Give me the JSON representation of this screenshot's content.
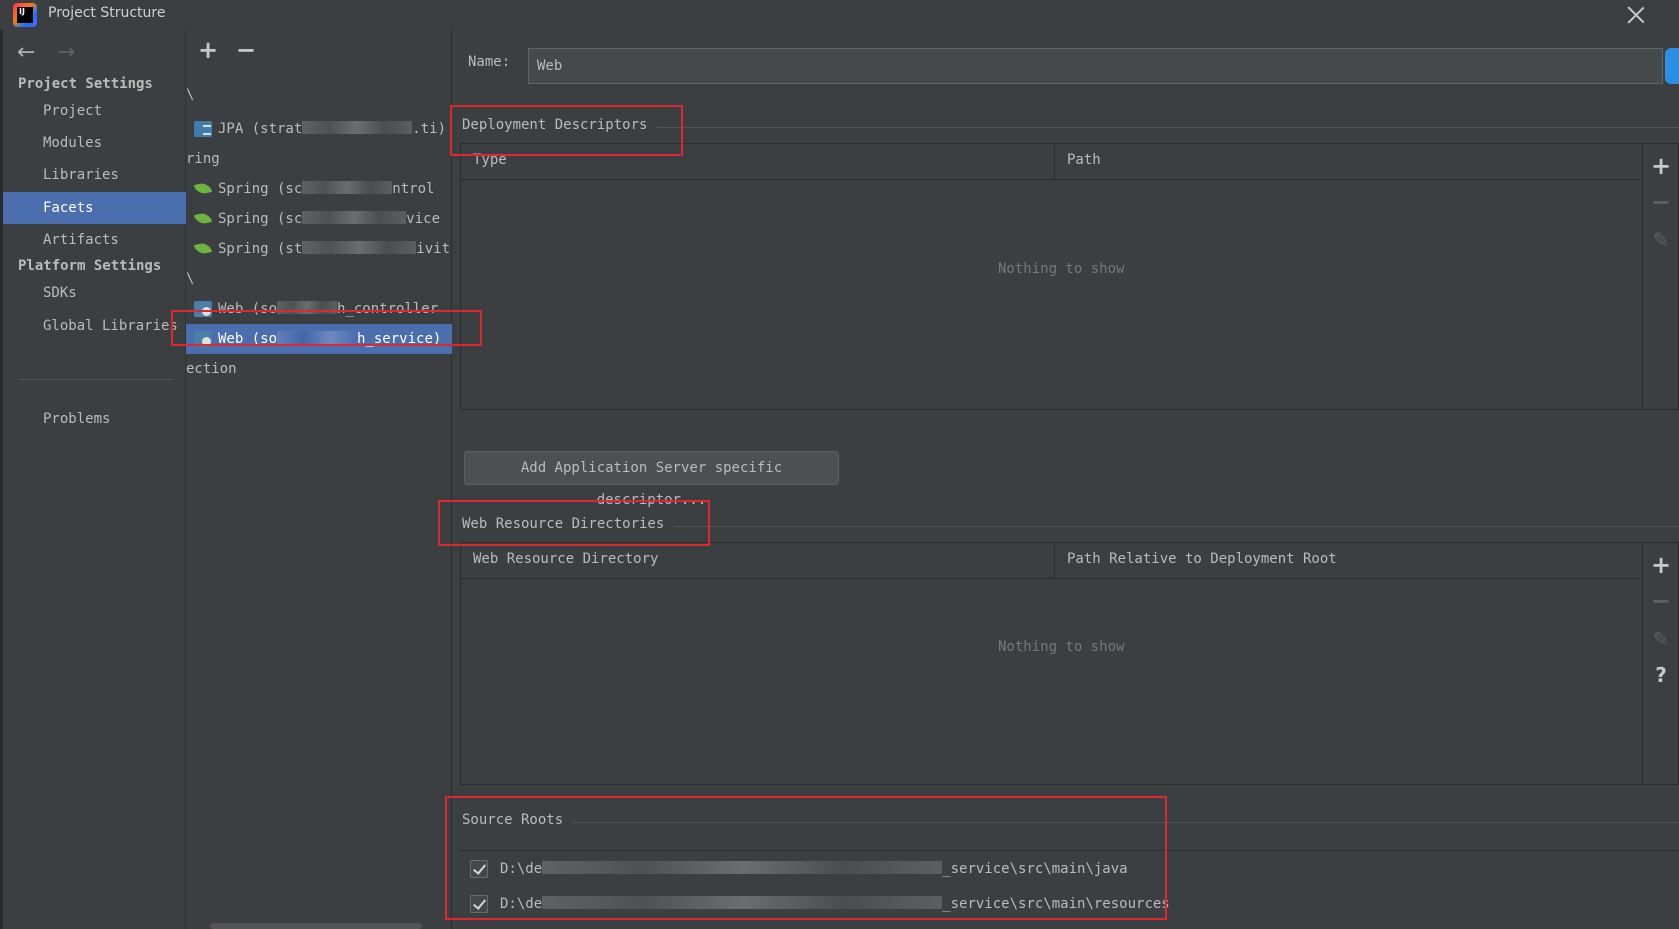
{
  "window": {
    "title": "Project Structure",
    "logo_text": "IJ"
  },
  "sidebar": {
    "project_settings_header": "Project Settings",
    "platform_settings_header": "Platform Settings",
    "items": [
      {
        "label": "Project"
      },
      {
        "label": "Modules"
      },
      {
        "label": "Libraries"
      },
      {
        "label": "Facets",
        "selected": true
      },
      {
        "label": "Artifacts"
      },
      {
        "label": "SDKs"
      },
      {
        "label": "Global Libraries"
      },
      {
        "label": "Problems"
      }
    ],
    "back_icon": "arrow-left-icon",
    "forward_icon": "arrow-right-icon"
  },
  "facet_list": {
    "toolbar": {
      "add": "+",
      "remove": "−"
    },
    "rows": [
      {
        "type": "group",
        "label": "\\"
      },
      {
        "type": "item",
        "icon": "jpa-icon",
        "prefix": "JPA (strat",
        "suffix": ".ti)"
      },
      {
        "type": "group",
        "label": "ring"
      },
      {
        "type": "item",
        "icon": "spring-icon",
        "prefix": "Spring (sc",
        "suffix": "ntrol"
      },
      {
        "type": "item",
        "icon": "spring-icon",
        "prefix": "Spring (sc",
        "suffix": "vice"
      },
      {
        "type": "item",
        "icon": "spring-icon",
        "prefix": "Spring (st",
        "suffix": "ivit"
      },
      {
        "type": "group",
        "label": "\\"
      },
      {
        "type": "item",
        "icon": "web-icon",
        "prefix": "Web (so",
        "suffix": "h_controller"
      },
      {
        "type": "item",
        "icon": "web-icon",
        "prefix": "Web (so",
        "suffix": "h_service)",
        "selected": true
      },
      {
        "type": "group",
        "label": "ection"
      }
    ]
  },
  "main": {
    "name_label": "Name:",
    "name_value": "Web",
    "deployment": {
      "title": "Deployment Descriptors",
      "columns": [
        "Type",
        "Path"
      ],
      "empty_text": "Nothing to show",
      "add_button": "Add Application Server specific descriptor..."
    },
    "web_resources": {
      "title": "Web Resource Directories",
      "columns": [
        "Web Resource Directory",
        "Path Relative to Deployment Root"
      ],
      "empty_text": "Nothing to show"
    },
    "source_roots": {
      "title": "Source Roots",
      "items": [
        {
          "prefix": "D:\\de",
          "suffix": "_service\\src\\main\\java",
          "checked": true
        },
        {
          "prefix": "D:\\de",
          "suffix": "_service\\src\\main\\resources",
          "checked": true
        }
      ]
    },
    "table_tools": {
      "add": "+",
      "remove": "−",
      "edit": "✎",
      "help": "?"
    }
  },
  "colors": {
    "selection": "#4b6eaf",
    "background": "#3c3f41",
    "highlight_box": "#e0262e",
    "spring_green": "#6cb33f"
  }
}
